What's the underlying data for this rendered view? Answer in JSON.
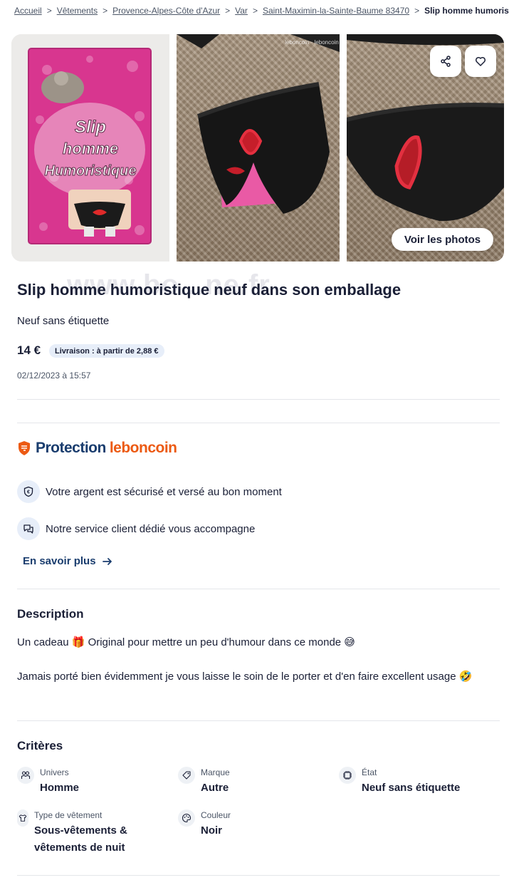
{
  "breadcrumb": {
    "items": [
      "Accueil",
      "Vêtements",
      "Provence-Alpes-Côte d'Azur",
      "Var",
      "Saint-Maximin-la-Sainte-Baume 83470"
    ],
    "current": "Slip homme humoristique neuf dans son emballage"
  },
  "gallery": {
    "box_line1": "Slip",
    "box_line2": "homme",
    "box_line3": "Humoristique",
    "watermark": "www.bo...ne.fr",
    "photo_tag": "leboncoin · leboncoin",
    "view_photos_label": "Voir les photos"
  },
  "ad": {
    "title": "Slip homme humoristique neuf dans son emballage",
    "condition": "Neuf sans étiquette",
    "price": "14 €",
    "delivery": "Livraison : à partir de 2,88 €",
    "date": "02/12/2023 à 15:57"
  },
  "protection": {
    "word1": "Protection",
    "word2": "leboncoin",
    "features": [
      "Votre argent est sécurisé et versé au bon moment",
      "Notre service client dédié vous accompagne"
    ],
    "learn_more": "En savoir plus"
  },
  "description": {
    "heading": "Description",
    "para1": "Un cadeau 🎁 Original pour mettre un peu d'humour dans ce monde 😅",
    "para2": "Jamais porté bien évidemment je vous laisse le soin de le porter et d'en faire excellent usage 🤣"
  },
  "criteria": {
    "heading": "Critères",
    "items": [
      {
        "label": "Univers",
        "value": "Homme",
        "icon": "people-icon"
      },
      {
        "label": "Marque",
        "value": "Autre",
        "icon": "tag-icon"
      },
      {
        "label": "État",
        "value": "Neuf sans étiquette",
        "icon": "chip-icon"
      },
      {
        "label": "Type de vêtement",
        "value": "Sous-vêtements & vêtements de nuit",
        "icon": "shirt-icon"
      },
      {
        "label": "Couleur",
        "value": "Noir",
        "icon": "palette-icon"
      }
    ]
  },
  "colors": {
    "primary": "#1a1f36",
    "leboncoin_orange": "#ec5a13",
    "navy": "#1a3d6e",
    "badge_bg": "#e7eef9"
  }
}
